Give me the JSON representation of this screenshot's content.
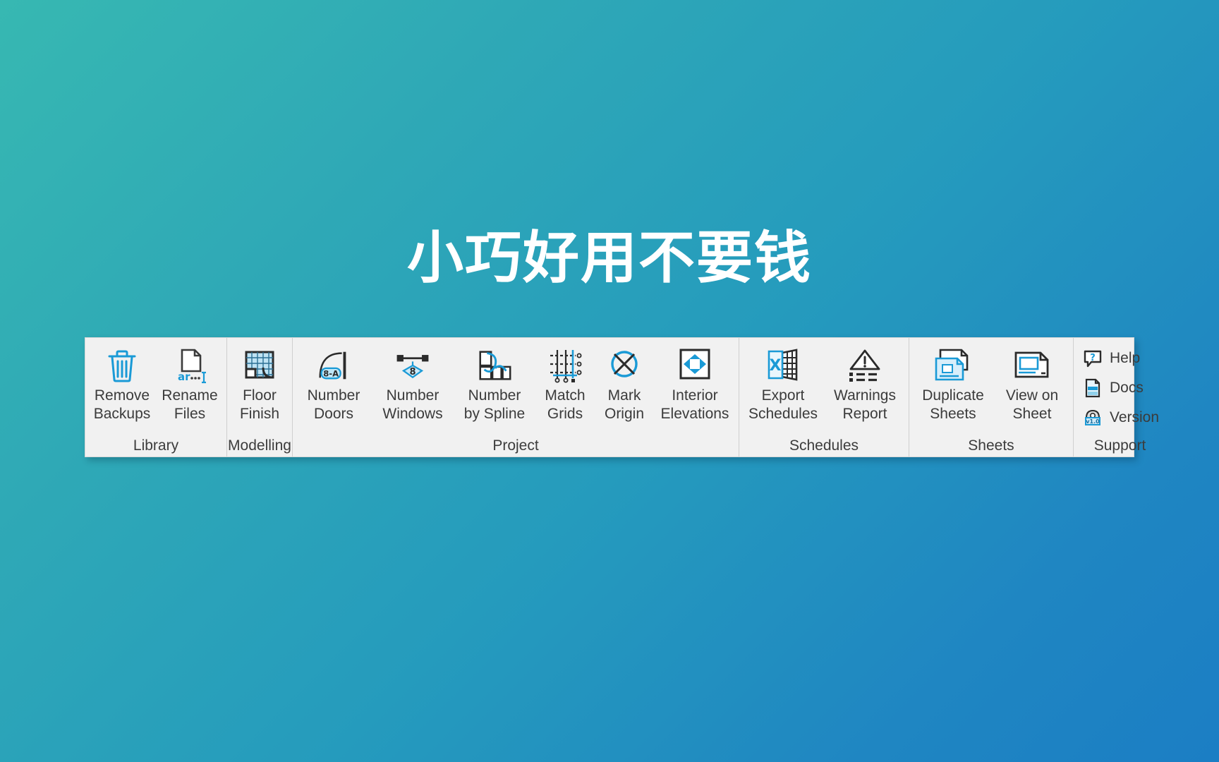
{
  "hero": {
    "title": "小巧好用不要钱"
  },
  "theme": {
    "bg_start": "#37b8b2",
    "bg_end": "#1b7ec4",
    "ribbon_bg": "#f1f1f1",
    "accent_blue": "#1a9ad6",
    "icon_dark": "#3b3b3b",
    "label_color": "#3b3b3b"
  },
  "ribbon": {
    "groups": [
      {
        "name": "library",
        "title": "Library",
        "buttons": [
          {
            "name": "remove-backups",
            "label": "Remove\nBackups",
            "icon": "trash-icon"
          },
          {
            "name": "rename-files",
            "label": "Rename\nFiles",
            "icon": "rename-file-icon"
          }
        ]
      },
      {
        "name": "modelling",
        "title": "Modelling",
        "buttons": [
          {
            "name": "floor-finish",
            "label": "Floor\nFinish",
            "icon": "floor-finish-icon"
          }
        ]
      },
      {
        "name": "project",
        "title": "Project",
        "buttons": [
          {
            "name": "number-doors",
            "label": "Number\nDoors",
            "icon": "door-tag-icon",
            "tag": "8-A"
          },
          {
            "name": "number-windows",
            "label": "Number\nWindows",
            "icon": "window-tag-icon",
            "tag": "8"
          },
          {
            "name": "number-by-spline",
            "label": "Number\nby Spline",
            "icon": "spline-rooms-icon"
          },
          {
            "name": "match-grids",
            "label": "Match\nGrids",
            "icon": "grid-match-icon"
          },
          {
            "name": "mark-origin",
            "label": "Mark\nOrigin",
            "icon": "origin-mark-icon"
          },
          {
            "name": "interior-elevations",
            "label": "Interior\nElevations",
            "icon": "interior-elevation-icon"
          }
        ]
      },
      {
        "name": "schedules",
        "title": "Schedules",
        "buttons": [
          {
            "name": "export-schedules",
            "label": "Export\nSchedules",
            "icon": "excel-export-icon"
          },
          {
            "name": "warnings-report",
            "label": "Warnings\nReport",
            "icon": "warning-list-icon"
          }
        ]
      },
      {
        "name": "sheets",
        "title": "Sheets",
        "buttons": [
          {
            "name": "duplicate-sheets",
            "label": "Duplicate\nSheets",
            "icon": "duplicate-sheet-icon"
          },
          {
            "name": "view-on-sheet",
            "label": "View on\nSheet",
            "icon": "view-on-sheet-icon"
          }
        ]
      },
      {
        "name": "support",
        "title": "Support",
        "buttons": [
          {
            "name": "help",
            "label": "Help",
            "icon": "help-bubble-icon"
          },
          {
            "name": "docs",
            "label": "Docs",
            "icon": "document-icon"
          },
          {
            "name": "version",
            "label": "Version",
            "icon": "version-badge-icon",
            "tag": "v1.0"
          }
        ]
      }
    ]
  }
}
